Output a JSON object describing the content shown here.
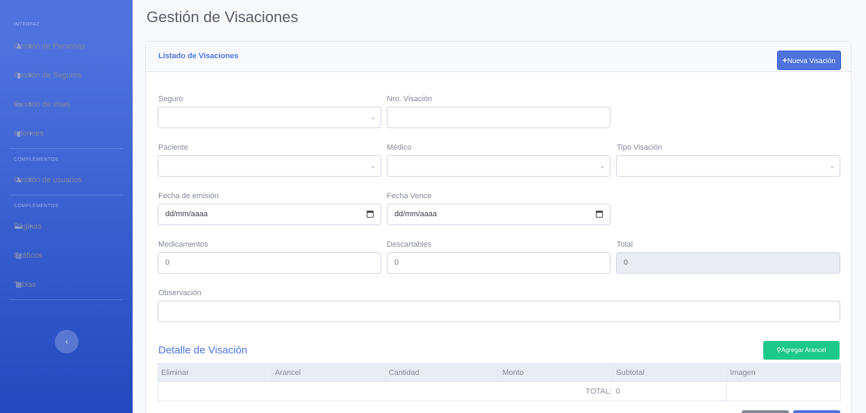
{
  "sidebar": {
    "heading_interfaz": "INTERFAZ",
    "heading_complementos_1": "COMPLEMENTOS",
    "heading_complementos_2": "COMPLEMENTOS",
    "items": [
      {
        "label": "Gestión de Personas",
        "icon": "user-icon"
      },
      {
        "label": "Gestión de Seguros",
        "icon": "file-icon"
      },
      {
        "label": "Gestión de visas",
        "icon": "card-icon"
      },
      {
        "label": "Informes",
        "icon": "document-icon"
      },
      {
        "label": "Gestión de usuarios",
        "icon": "users-icon"
      },
      {
        "label": "Páginas",
        "icon": "folder-icon"
      },
      {
        "label": "Gráficos",
        "icon": "chart-icon"
      },
      {
        "label": "Tablas",
        "icon": "table-icon"
      }
    ],
    "toggle_icon": "chevron-left-icon"
  },
  "page": {
    "title": "Gestión de Visaciones"
  },
  "card": {
    "title": "Listado de Visaciones",
    "new_button": "Nueva Visación"
  },
  "form": {
    "seguro_label": "Seguro",
    "nro_visacion_label": "Nro. Visación",
    "paciente_label": "Paciente",
    "medico_label": "Médico",
    "tipo_visacion_label": "Tipo Visación",
    "fecha_emision_label": "Fecha de emisión",
    "fecha_emision_value": "dd/mm/aaaa",
    "fecha_vence_label": "Fecha Vence",
    "fecha_vence_value": "dd/mm/aaaa",
    "medicamentos_label": "Medicamentos",
    "medicamentos_value": "0",
    "descartables_label": "Descartables",
    "descartables_value": "0",
    "total_label": "Total",
    "total_value": "0",
    "observacion_label": "Observación"
  },
  "detail": {
    "title": "Detalle de Visación",
    "add_button": "Agregar Arancel",
    "columns": [
      "Eliminar",
      "Arancel",
      "Cantidad",
      "Monto",
      "Subtotal",
      "Imagen"
    ],
    "total_label": "TOTAL:",
    "total_value": "0"
  }
}
